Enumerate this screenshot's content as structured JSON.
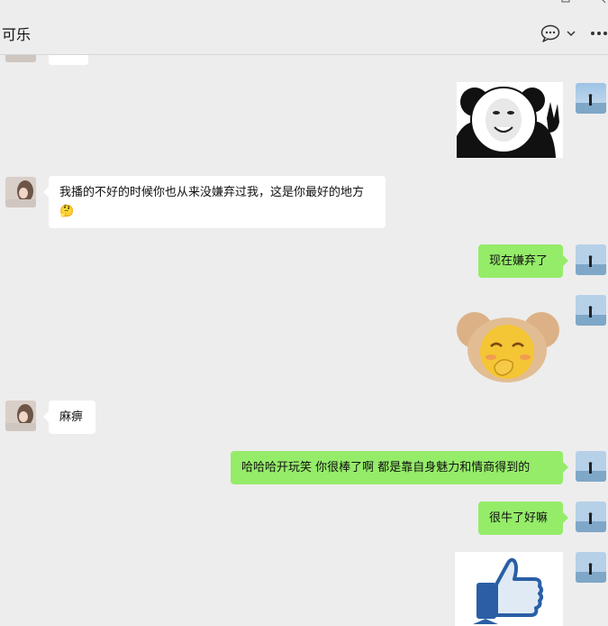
{
  "window": {
    "controls": [
      "minimize-icon",
      "maximize-icon",
      "close-icon"
    ]
  },
  "header": {
    "title": "可乐",
    "icons": [
      "chat-bubble-icon",
      "chevron-down-icon",
      "more-icon"
    ]
  },
  "messages": [
    {
      "side": "in",
      "kind": "sticker",
      "content": "emoji sticker (partially visible)"
    },
    {
      "side": "out",
      "kind": "sticker",
      "content": "panda meme peace sign"
    },
    {
      "side": "in",
      "kind": "text",
      "text": "我播的不好的时候你也从来没嫌弃过我，这是你最好的地方",
      "emoji": "🤔"
    },
    {
      "side": "out",
      "kind": "text",
      "text": "现在嫌弃了"
    },
    {
      "side": "out",
      "kind": "sticker",
      "content": "bear emoji covering mouth"
    },
    {
      "side": "in",
      "kind": "text",
      "text": "麻痹"
    },
    {
      "side": "out",
      "kind": "text",
      "text": "哈哈哈开玩笑 你很棒了啊 都是靠自身魅力和情商得到的"
    },
    {
      "side": "out",
      "kind": "text",
      "text": "很牛了好嘛"
    },
    {
      "side": "out",
      "kind": "sticker",
      "content": "thumbs-up"
    }
  ],
  "colors": {
    "background": "#ededed",
    "incoming_bubble": "#ffffff",
    "outgoing_bubble": "#95ec69",
    "thumb_blue": "#2a5fa5"
  }
}
